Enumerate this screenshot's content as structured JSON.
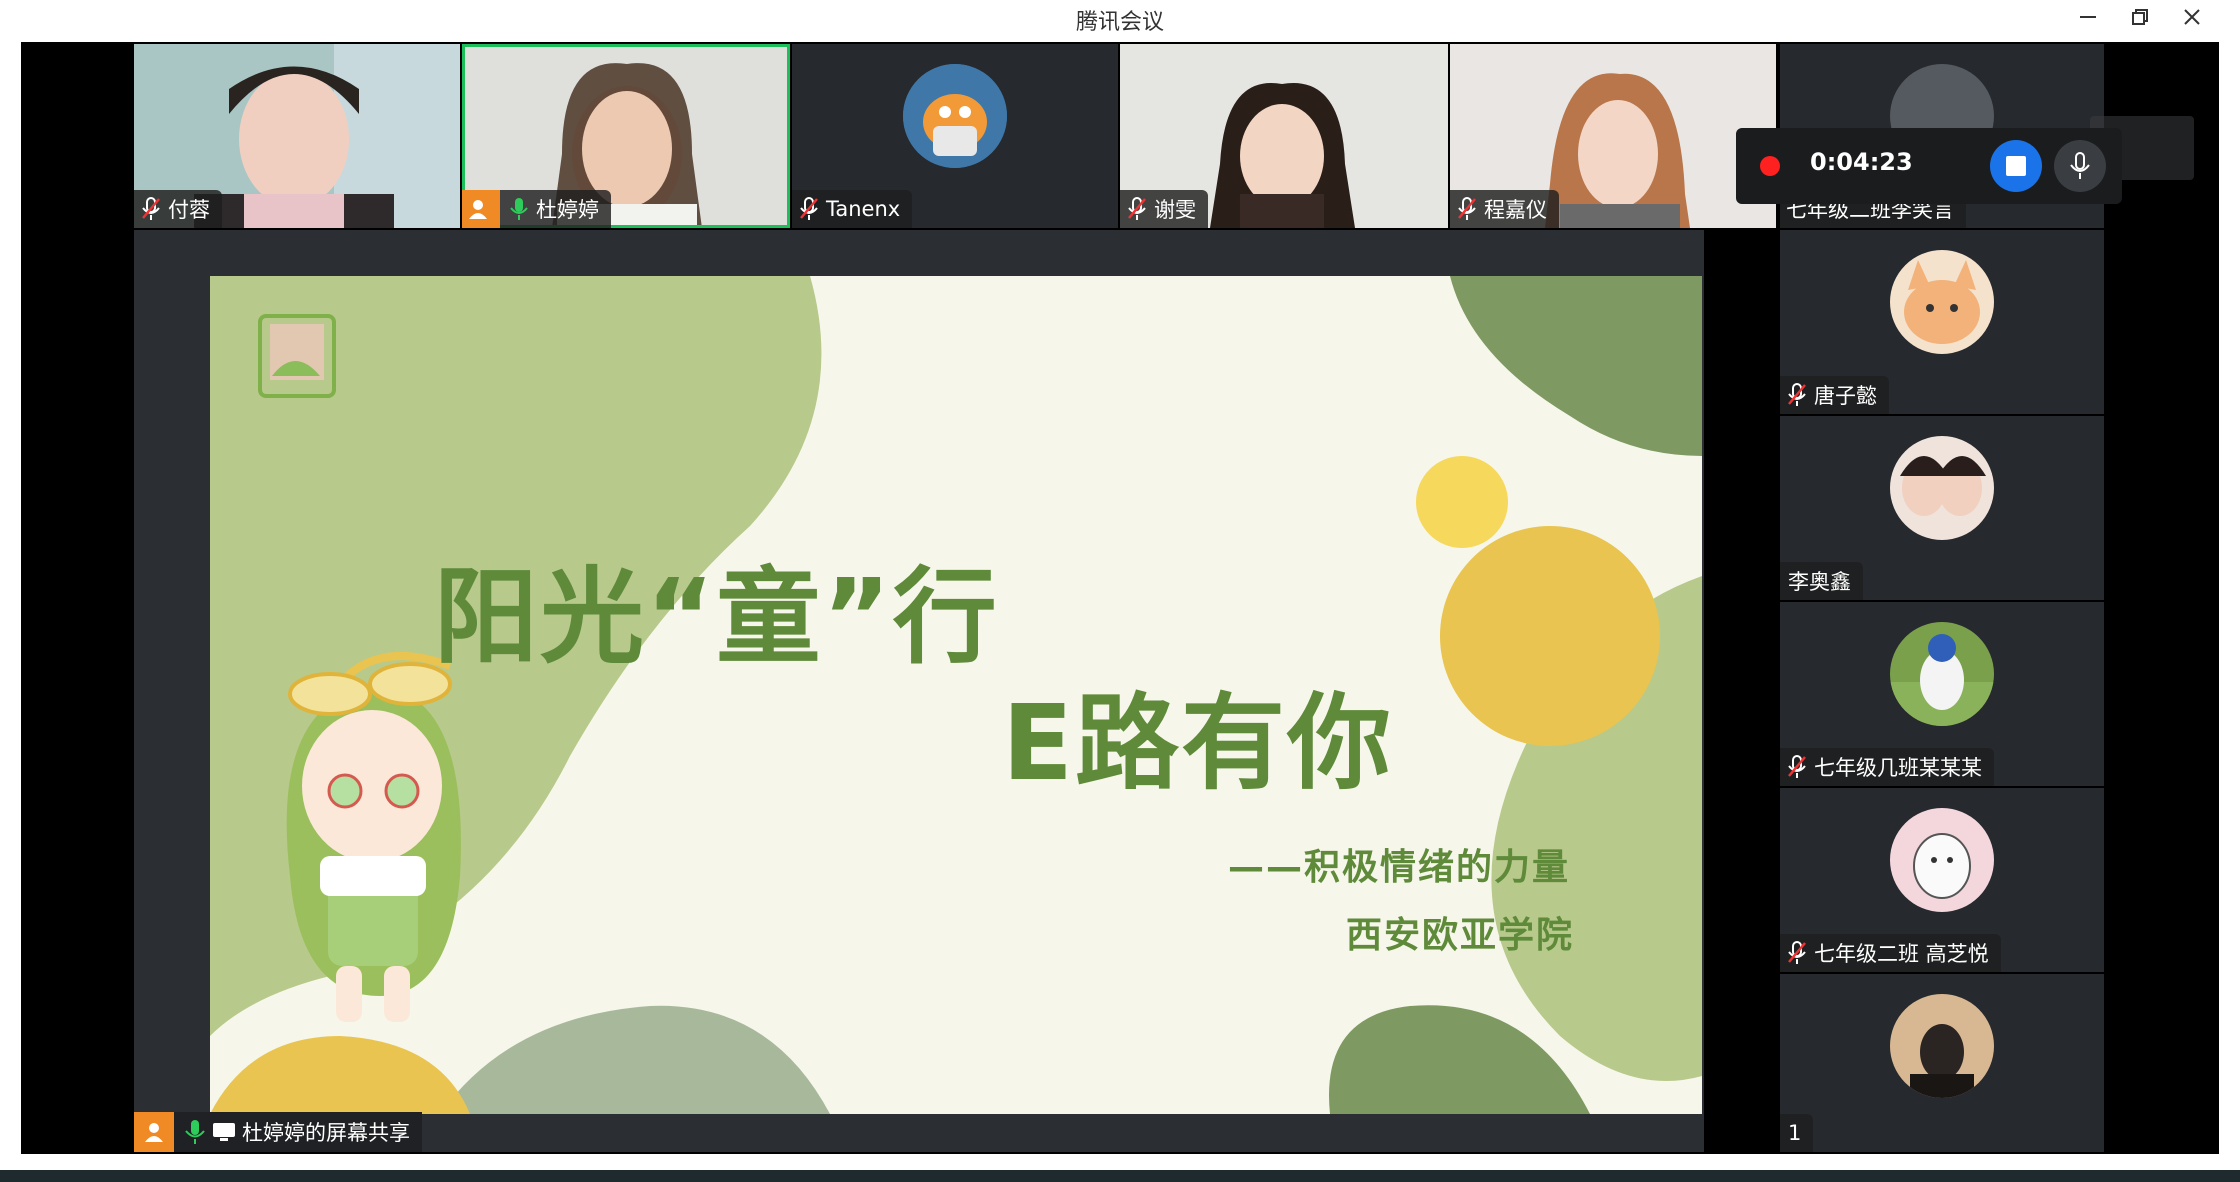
{
  "window": {
    "title": "腾讯会议",
    "minimize_icon": "minimize-icon",
    "restore_icon": "restore-icon",
    "close_icon": "close-icon"
  },
  "top_strip": [
    {
      "name": "付蓉",
      "muted": true
    },
    {
      "name": "杜婷婷",
      "muted": false,
      "speaking": true,
      "host": true
    },
    {
      "name": "Tanenx",
      "muted": true
    },
    {
      "name": "谢雯",
      "muted": true
    },
    {
      "name": "程嘉仪",
      "muted": true
    }
  ],
  "sidebar": [
    {
      "name": "七年级二班李笑言",
      "muted": false
    },
    {
      "name": "唐子懿",
      "muted": true
    },
    {
      "name": "李奥鑫",
      "muted": false
    },
    {
      "name": "七年级几班某某某",
      "muted": true
    },
    {
      "name": "七年级二班 高芝悦",
      "muted": true
    },
    {
      "name": "1",
      "muted": false
    }
  ],
  "recording": {
    "time": "0:04:23",
    "stop_icon": "stop-icon",
    "mic_icon": "microphone-icon",
    "status_color": "#ff2020",
    "stop_color": "#1a73e8"
  },
  "slide": {
    "title_line1": "阳光“童”行",
    "title_line2": "E路有你",
    "subtitle": "——积极情绪的力量",
    "school": "西安欧亚学院",
    "accent_color": "#5e8a3a"
  },
  "share": {
    "label": "杜婷婷的屏幕共享"
  }
}
